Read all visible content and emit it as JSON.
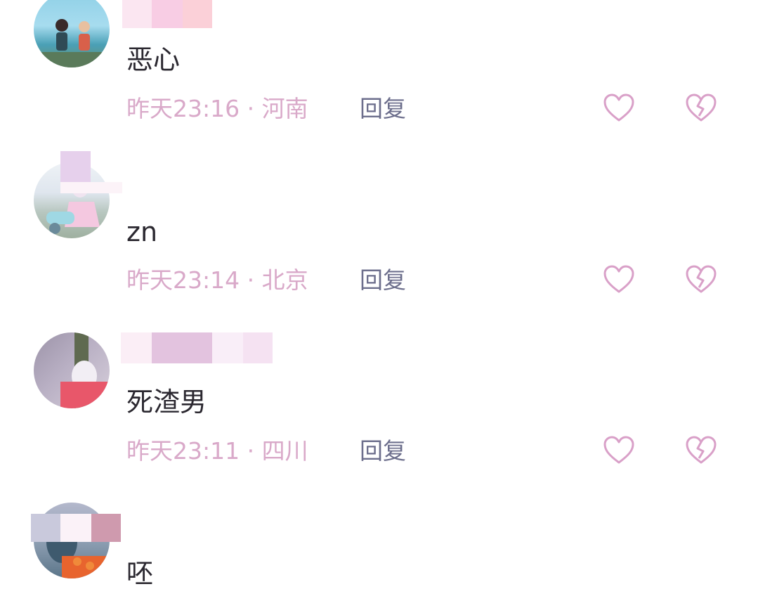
{
  "comments": [
    {
      "text": "恶心",
      "time": "昨天23:16",
      "separator": "·",
      "location": "河南",
      "reply_label": "回复"
    },
    {
      "text": "zn",
      "time": "昨天23:14",
      "separator": "·",
      "location": "北京",
      "reply_label": "回复"
    },
    {
      "text": "死渣男",
      "time": "昨天23:11",
      "separator": "·",
      "location": "四川",
      "reply_label": "回复"
    },
    {
      "text": "呸"
    }
  ],
  "icons": {
    "like": "heart-outline-icon",
    "dislike": "broken-heart-icon"
  },
  "colors": {
    "meta": "#d9a9c9",
    "reply": "#6c6e8c",
    "icon": "#d9a0c8",
    "text": "#2b2830"
  }
}
